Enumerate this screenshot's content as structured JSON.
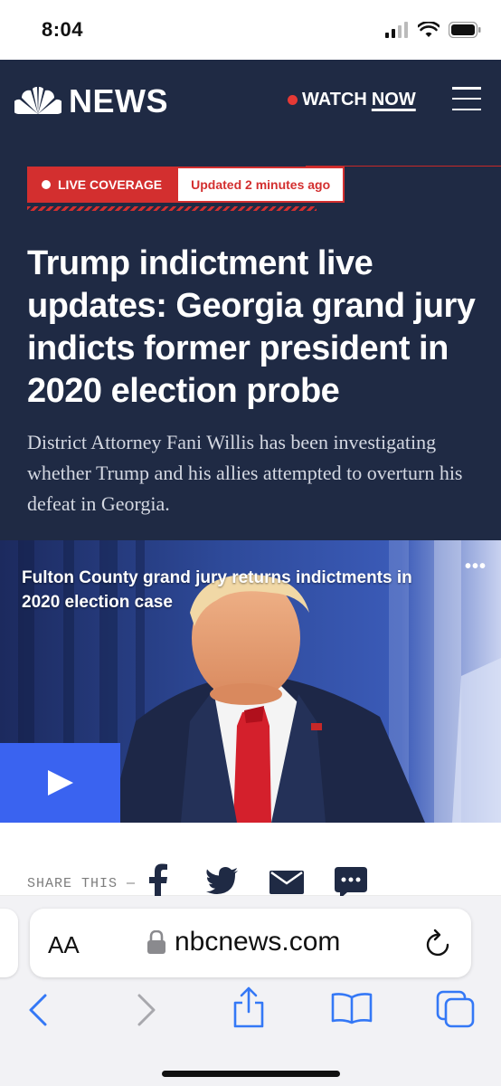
{
  "status_bar": {
    "time": "8:04"
  },
  "header": {
    "brand": "NEWS",
    "watch_label": "WATCH",
    "now_label": "NOW",
    "menu_icon": "hamburger-menu-icon"
  },
  "hero": {
    "badge_live": "LIVE COVERAGE",
    "badge_updated": "Updated 2 minutes ago",
    "headline": "Trump indictment live updates: Georgia grand jury indicts former president in 2020 election probe",
    "dek": "District Attorney Fani Willis has been investigating whether Trump and his allies attempted to overturn his defeat in Georgia."
  },
  "video": {
    "caption": "Fulton County grand jury returns indictments in 2020 election case",
    "more_label": "•••",
    "play_icon": "play-icon"
  },
  "share": {
    "label": "SHARE THIS —",
    "icons": [
      "facebook-icon",
      "twitter-icon",
      "email-icon",
      "comment-icon"
    ]
  },
  "safari": {
    "aa_label": "AA",
    "url": "nbcnews.com",
    "toolbar_icons": [
      "back-icon",
      "forward-icon",
      "share-icon",
      "bookmarks-icon",
      "tabs-icon"
    ]
  },
  "colors": {
    "header_bg": "#1f2a44",
    "accent_red": "#d32f2f",
    "play_blue": "#3a63f0",
    "ios_blue": "#3478f6"
  }
}
